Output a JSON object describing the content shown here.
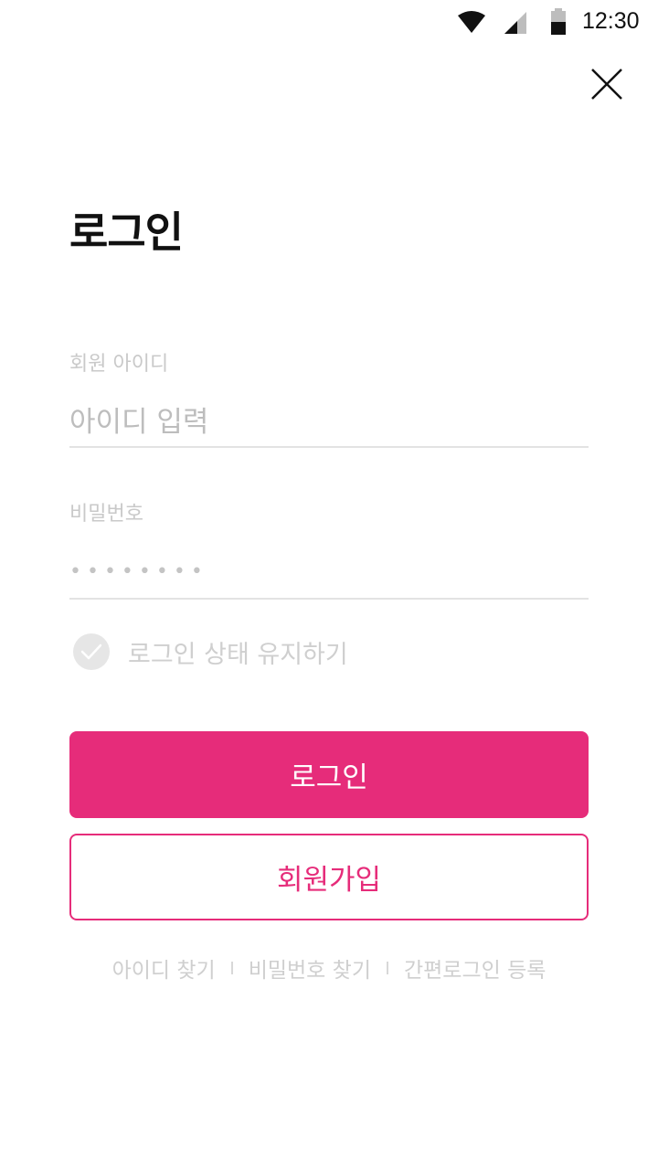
{
  "status_bar": {
    "time": "12:30",
    "icons": [
      "wifi-icon",
      "cellular-signal-icon",
      "battery-icon"
    ]
  },
  "header": {
    "close_icon": "close-icon"
  },
  "title": "로그인",
  "id_field": {
    "label": "회원 아이디",
    "placeholder": "아이디 입력",
    "value": ""
  },
  "password_field": {
    "label": "비밀번호",
    "masked_value": "••••••••"
  },
  "keep_login": {
    "label": "로그인 상태 유지하기",
    "checked": false
  },
  "buttons": {
    "login": "로그인",
    "signup": "회원가입"
  },
  "links": [
    {
      "label": "아이디 찾기"
    },
    {
      "label": "비밀번호 찾기"
    },
    {
      "label": "간편로그인 등록"
    }
  ],
  "colors": {
    "accent": "#e62c7a",
    "placeholder": "#bdbdbd",
    "divider": "#e3e3e3"
  }
}
